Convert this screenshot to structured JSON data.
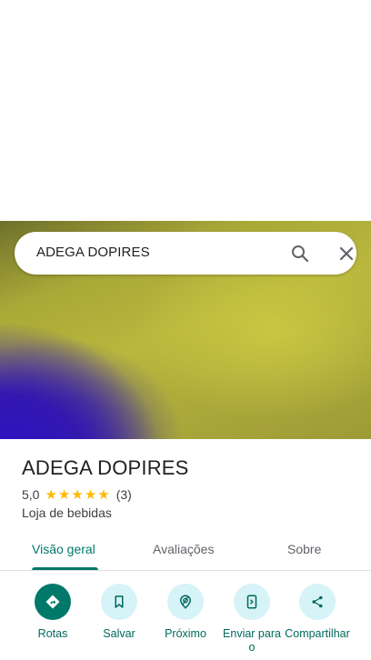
{
  "search": {
    "query": "ADEGA DOPIRES"
  },
  "place": {
    "name": "ADEGA DOPIRES",
    "rating": "5,0",
    "stars": 5,
    "review_count": "(3)",
    "category": "Loja de bebidas"
  },
  "tabs": [
    {
      "label": "Visão geral",
      "active": true
    },
    {
      "label": "Avaliações",
      "active": false
    },
    {
      "label": "Sobre",
      "active": false
    }
  ],
  "actions": [
    {
      "label": "Rotas",
      "icon": "directions-icon"
    },
    {
      "label": "Salvar",
      "icon": "bookmark-icon"
    },
    {
      "label": "Próximo",
      "icon": "nearby-icon"
    },
    {
      "label": "Enviar para o",
      "icon": "send-to-phone-icon"
    },
    {
      "label": "Compartilhar",
      "icon": "share-icon"
    }
  ],
  "colors": {
    "accent": "#00796b",
    "action_bg": "#d6f3f7",
    "star": "#fbbc04"
  }
}
